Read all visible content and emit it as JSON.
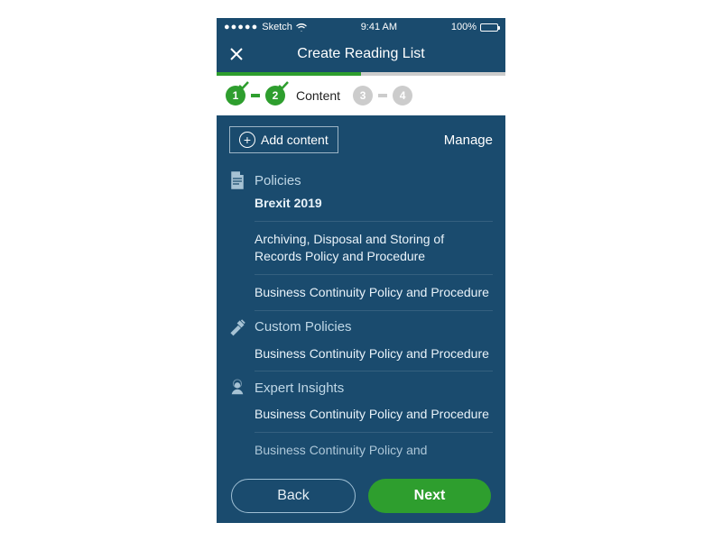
{
  "status": {
    "carrier": "Sketch",
    "time": "9:41 AM",
    "battery": "100%"
  },
  "nav": {
    "title": "Create Reading List"
  },
  "stepper": {
    "steps": [
      {
        "num": "1",
        "state": "done"
      },
      {
        "num": "2",
        "state": "done",
        "label": "Content"
      },
      {
        "num": "3",
        "state": "inactive"
      },
      {
        "num": "4",
        "state": "inactive"
      }
    ]
  },
  "toolbar": {
    "add": "Add content",
    "manage": "Manage"
  },
  "sections": [
    {
      "title": "Policies",
      "icon": "document",
      "items": [
        "Brexit 2019",
        "Archiving, Disposal and Storing of Records Policy and Procedure",
        "Business Continuity Policy and Procedure"
      ]
    },
    {
      "title": "Custom Policies",
      "icon": "tools",
      "items": [
        "Business Continuity Policy and Procedure"
      ]
    },
    {
      "title": "Expert Insights",
      "icon": "expert",
      "items": [
        "Business Continuity Policy and Procedure",
        "Business Continuity Policy and"
      ]
    }
  ],
  "footer": {
    "back": "Back",
    "next": "Next"
  }
}
